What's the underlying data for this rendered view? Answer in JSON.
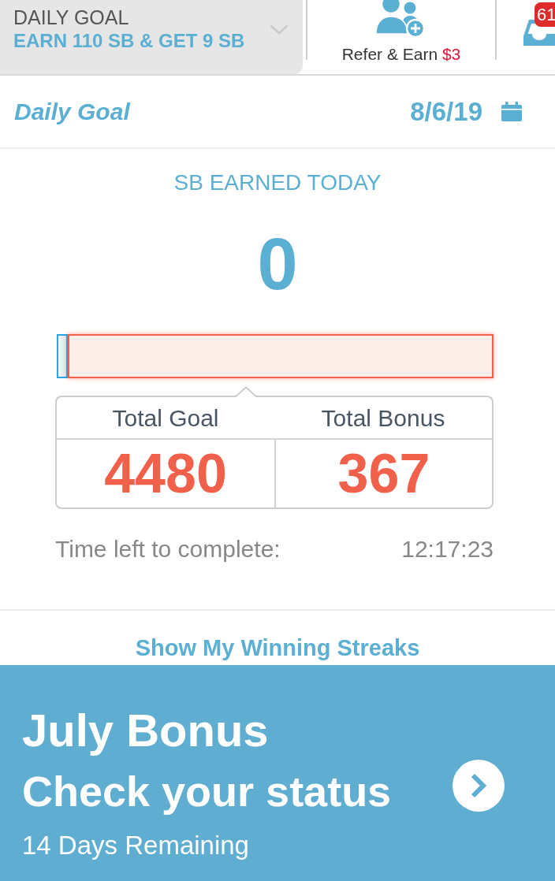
{
  "header": {
    "goal_label": "DAILY GOAL",
    "goal_text": "EARN 110 SB & GET 9 SB",
    "refer": {
      "label": "Refer & Earn",
      "amount": "$3"
    },
    "inbox": {
      "badge": "61"
    }
  },
  "daily_goal": {
    "title": "Daily Goal",
    "date": "8/6/19"
  },
  "earned": {
    "label": "SB EARNED TODAY",
    "value": "0",
    "progress": {
      "level": 0.025
    }
  },
  "totals": [
    {
      "label": "Total Goal",
      "value": "4480"
    },
    {
      "label": "Total Bonus",
      "value": "367"
    }
  ],
  "time_left": {
    "label": "Time left to complete:",
    "value": "12:17:23"
  },
  "streaks_link": "Show My Winning Streaks",
  "banner": {
    "title": "July Bonus",
    "subtitle": "Check your status",
    "remaining": "14 Days Remaining"
  }
}
